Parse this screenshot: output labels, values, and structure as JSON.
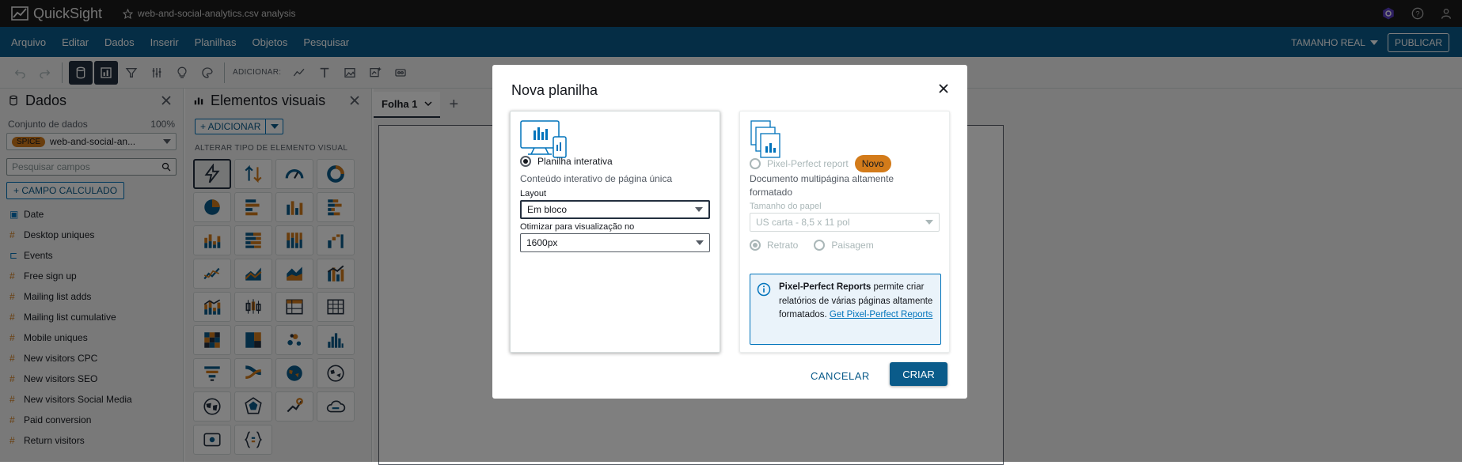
{
  "app": {
    "name": "QuickSight",
    "file_title": "web-and-social-analytics.csv analysis"
  },
  "menu": {
    "items": [
      "Arquivo",
      "Editar",
      "Dados",
      "Inserir",
      "Planilhas",
      "Objetos",
      "Pesquisar"
    ],
    "size_label": "TAMANHO REAL",
    "publish_label": "PUBLICAR"
  },
  "toolbar": {
    "add_label": "ADICIONAR:"
  },
  "data_panel": {
    "title": "Dados",
    "dataset_label": "Conjunto de dados",
    "dataset_percent": "100%",
    "spice_badge": "SPICE",
    "dataset_name": "web-and-social-an...",
    "search_placeholder": "Pesquisar campos",
    "calc_field_label": "+ CAMPO CALCULADO",
    "fields": [
      {
        "type": "date",
        "name": "Date"
      },
      {
        "type": "measure",
        "name": "Desktop uniques"
      },
      {
        "type": "dimension",
        "name": "Events"
      },
      {
        "type": "measure",
        "name": "Free sign up"
      },
      {
        "type": "measure",
        "name": "Mailing list adds"
      },
      {
        "type": "measure",
        "name": "Mailing list cumulative"
      },
      {
        "type": "measure",
        "name": "Mobile uniques"
      },
      {
        "type": "measure",
        "name": "New visitors CPC"
      },
      {
        "type": "measure",
        "name": "New visitors SEO"
      },
      {
        "type": "measure",
        "name": "New visitors Social Media"
      },
      {
        "type": "measure",
        "name": "Paid conversion"
      },
      {
        "type": "measure",
        "name": "Return visitors"
      }
    ]
  },
  "visuals_panel": {
    "title": "Elementos visuais",
    "add_label": "+ ADICIONAR",
    "change_type_label": "ALTERAR TIPO DE ELEMENTO VISUAL",
    "visual_types": [
      "autograph-icon",
      "kpi-icon",
      "gauge-icon",
      "donut-icon",
      "pie-icon",
      "horizontal-bar-icon",
      "vertical-bar-icon",
      "horizontal-stacked-bar-icon",
      "vertical-stacked-bar-icon",
      "horizontal-stacked-100-icon",
      "vertical-stacked-100-icon",
      "waterfall-icon",
      "line-icon",
      "area-icon",
      "stacked-area-icon",
      "combo-icon",
      "combo-line-icon",
      "box-plot-icon",
      "pivot-table-icon",
      "table-icon",
      "heatmap-icon",
      "treemap-icon",
      "scatter-icon",
      "histogram-icon",
      "funnel-icon",
      "sankey-icon",
      "filled-map-icon",
      "points-map-icon",
      "geo-icon",
      "radar-icon",
      "insight-icon",
      "word-cloud-icon",
      "custom-content-icon",
      "text-box-icon"
    ]
  },
  "sheet": {
    "tab_label": "Folha 1"
  },
  "modal": {
    "title": "Nova planilha",
    "interactive": {
      "label": "Planilha interativa",
      "description": "Conteúdo interativo de página única",
      "layout_label": "Layout",
      "layout_value": "Em bloco",
      "optimize_label": "Otimizar para visualização no",
      "optimize_value": "1600px"
    },
    "pixel_perfect": {
      "label": "Pixel-Perfect report",
      "badge": "Novo",
      "description_line1": "Documento multipágina altamente",
      "description_line2": "formatado",
      "paper_label": "Tamanho do papel",
      "paper_value": "US carta - 8,5 x 11 pol",
      "portrait_label": "Retrato",
      "landscape_label": "Paisagem",
      "info_bold": "Pixel-Perfect Reports",
      "info_text": " permite criar relatórios de várias páginas altamente formatados. ",
      "info_link": "Get Pixel-Perfect Reports"
    },
    "cancel_label": "CANCELAR",
    "create_label": "CRIAR"
  }
}
